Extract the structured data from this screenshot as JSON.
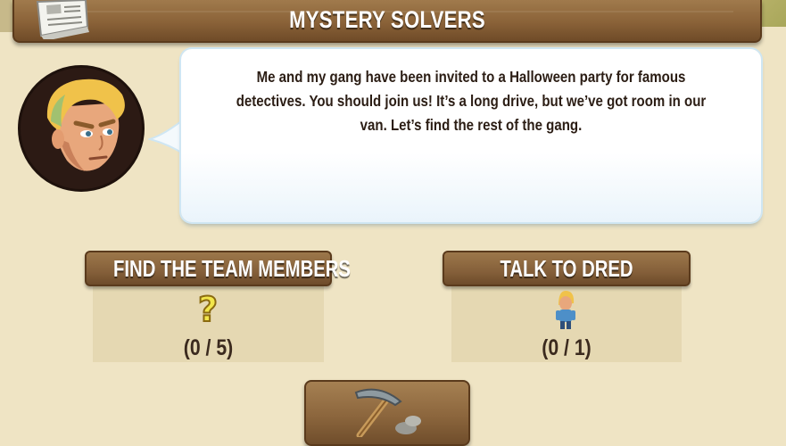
{
  "title_bar": {
    "title": "MYSTERY SOLVERS",
    "icon": "newspaper-icon"
  },
  "dialog": {
    "speaker_icon": "fred-portrait",
    "message": "Me and my gang have been invited to a Halloween party for famous detectives. You should join us! It’s a long drive, but we’ve got room in our van. Let’s find the rest of the gang."
  },
  "tasks": [
    {
      "label": "FIND THE TEAM MEMBERS",
      "icon": "question-mark-icon",
      "progress": "(0 / 5)",
      "current": 0,
      "total": 5
    },
    {
      "label": "TALK TO DRED",
      "icon": "dred-character-icon",
      "progress": "(0 / 1)",
      "current": 0,
      "total": 1
    }
  ],
  "action_button": {
    "icon": "pickaxe-icon"
  },
  "colors": {
    "background": "#efe4c4",
    "wood": "#8a6238",
    "panel": "#e5d8b2",
    "text": "#2b1d14",
    "question_mark": "#f2e64a"
  }
}
